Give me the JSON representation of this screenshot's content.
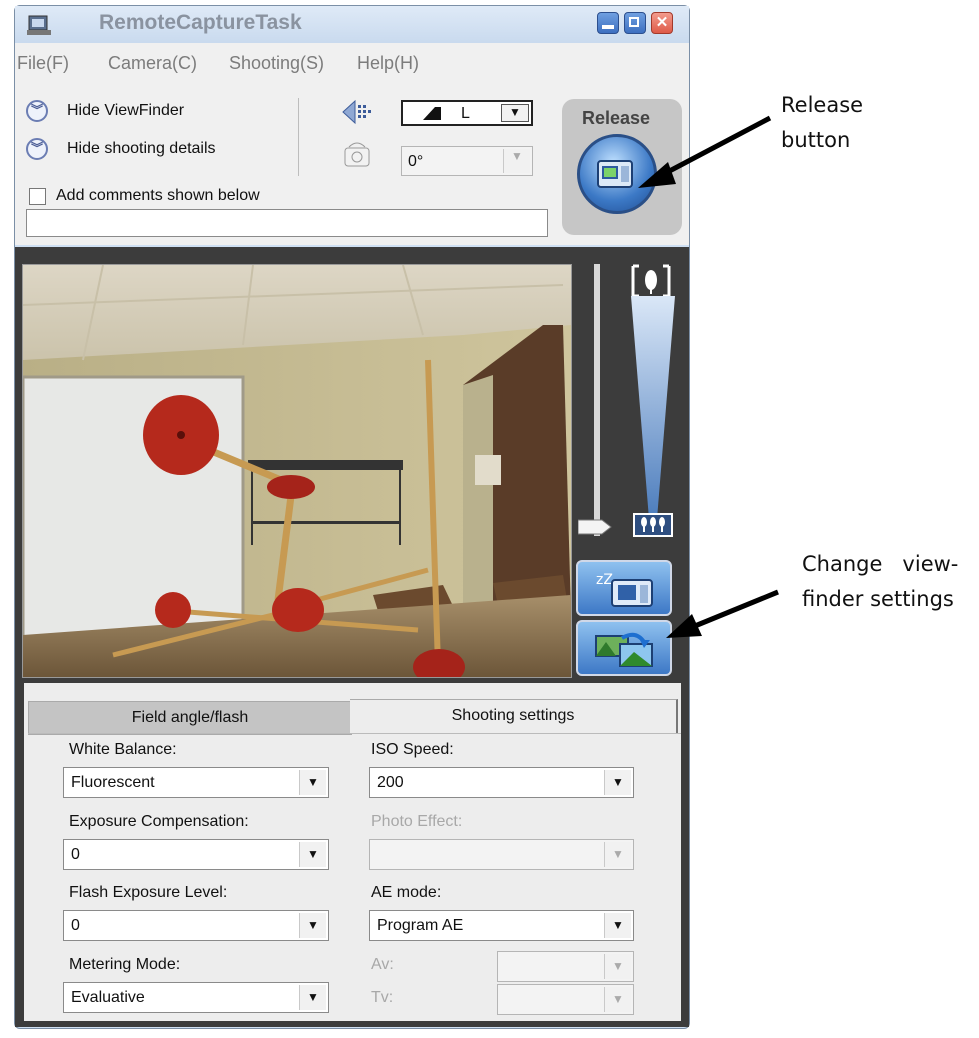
{
  "window": {
    "title": "RemoteCaptureTask"
  },
  "menu": [
    "File(F)",
    "Camera(C)",
    "Shooting(S)",
    "Help(H)"
  ],
  "toolbar": {
    "hide_viewfinder": "Hide ViewFinder",
    "hide_shooting_details": "Hide shooting details",
    "add_comments_label": "Add comments shown below",
    "add_comments_checked": false,
    "comment_value": "",
    "image_size_value": "L",
    "rotation_value": "0°"
  },
  "release": {
    "label": "Release"
  },
  "tabs": [
    {
      "label": "Field angle/flash",
      "active": false
    },
    {
      "label": "Shooting settings",
      "active": true
    }
  ],
  "settings": {
    "white_balance": {
      "label": "White Balance:",
      "value": "Fluorescent"
    },
    "exposure_comp": {
      "label": "Exposure Compensation:",
      "value": "0"
    },
    "flash_exposure": {
      "label": "Flash Exposure Level:",
      "value": "0"
    },
    "metering": {
      "label": "Metering Mode:",
      "value": "Evaluative"
    },
    "iso": {
      "label": "ISO Speed:",
      "value": "200"
    },
    "photo_effect": {
      "label": "Photo Effect:",
      "value": ""
    },
    "ae_mode": {
      "label": "AE mode:",
      "value": "Program AE"
    },
    "av": {
      "label": "Av:",
      "value": ""
    },
    "tv": {
      "label": "Tv:",
      "value": ""
    }
  },
  "annotations": {
    "release_line1": "Release",
    "release_line2": "button",
    "viewfinder_line1": "Change   view-",
    "viewfinder_line2": "finder settings"
  },
  "colors": {
    "accent": "#3d78c6",
    "dark_panel": "#3c3c3c",
    "title_text": "#8a93a0"
  }
}
